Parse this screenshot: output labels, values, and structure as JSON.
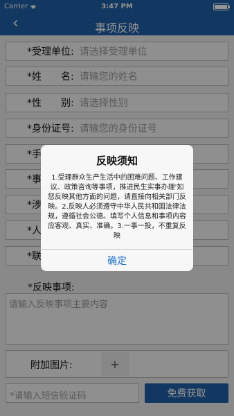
{
  "status_bar": {
    "carrier": "Carrier",
    "time": "3:47 PM"
  },
  "nav": {
    "back_icon": "chevron-left-icon",
    "back": "‹",
    "title": "事项反映"
  },
  "form": {
    "fields": [
      {
        "label": "*受理单位:",
        "value": "请选择受理单位"
      },
      {
        "label": "*姓　　名:",
        "value": "请输您的姓名"
      },
      {
        "label": "*性　　别:",
        "value": "请选择性别"
      },
      {
        "label": "*身份证号:",
        "value": "请输您的身份证号"
      },
      {
        "label": "*手",
        "value": ""
      },
      {
        "label": "*事",
        "value": ""
      },
      {
        "label": "*涉",
        "value": ""
      },
      {
        "label": "*人",
        "value": ""
      },
      {
        "label": "*联",
        "value": ""
      }
    ],
    "report_label": "*反映事项:",
    "report_placeholder": "请输入反映事项主要内容",
    "attach_label": "附加图片:",
    "attach_button": "+",
    "sms_placeholder": "*请输入短信验证码",
    "get_code_button": "免费获取"
  },
  "dialog": {
    "title": "反映须知",
    "body": "1.受理群众生产生活中的困难问题、工作建议、政策咨询等事项，推进民生实事办理'如您反映其他方面的问题，请直接向相关部门反映。2.反映人必须遵守中华人民共和国法律法规，遵循社会公德。填写个人信息和事项内容应客观、真实、准确。3.一事一投，不重复反映",
    "confirm": "确定"
  },
  "colors": {
    "primary": "#1f5fa6",
    "link": "#1f72c7"
  }
}
